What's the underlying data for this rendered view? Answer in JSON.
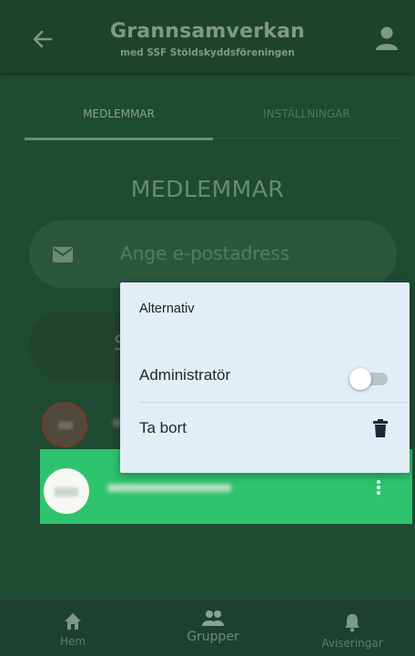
{
  "header": {
    "title": "Grannsamverkan",
    "subtitle": "med SSF Stöldskyddsföreningen",
    "back_icon": "arrow-left",
    "profile_icon": "person"
  },
  "tabs": [
    {
      "label": "MEDLEMMAR",
      "selected": true
    },
    {
      "label": "INSTÄLLNINGAR",
      "selected": false
    }
  ],
  "main": {
    "section_title": "MEDLEMMAR",
    "email_placeholder": "Ange e-postadress",
    "email_value": "",
    "send_button_partial": "S"
  },
  "menu": {
    "title": "Alternativ",
    "admin_label": "Administratör",
    "admin_enabled": false,
    "delete_label": "Ta bort",
    "delete_icon": "trash"
  },
  "bottom_nav": [
    {
      "label": "Hem",
      "icon": "home"
    },
    {
      "label": "Grupper",
      "icon": "group",
      "active": true
    },
    {
      "label": "Aviseringar",
      "icon": "bell"
    }
  ],
  "colors": {
    "accent_green": "#2ec46e",
    "header_bg": "#1d432f",
    "menu_bg": "#e1eef5"
  }
}
